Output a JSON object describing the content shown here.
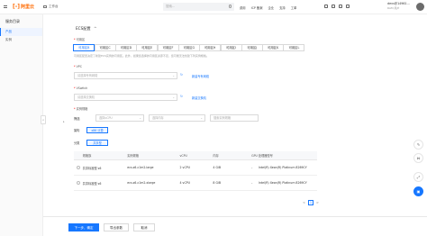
{
  "topbar": {
    "logo_text": "阿里云",
    "workspace": "工作台",
    "search_placeholder": "搜索...",
    "nav": [
      "费用",
      "ICP 备案",
      "企业",
      "支持",
      "工单"
    ],
    "user_name": "devs@14961...",
    "user_sub": "RAM 用户"
  },
  "sidebar": {
    "title": "服务目录",
    "items": [
      {
        "label": "产品",
        "active": true
      },
      {
        "label": "实例",
        "active": false
      }
    ],
    "collapse": "<"
  },
  "section": {
    "title": "ECS配置",
    "toggle": "^"
  },
  "zone": {
    "label": "可用区",
    "options": [
      "可用区B",
      "可用区C",
      "可用区D",
      "可用区E",
      "可用区F",
      "可用区G",
      "可用区H",
      "可用区I",
      "可用区J",
      "可用区K",
      "可用区L"
    ],
    "selected": 0,
    "description": "可用区配置决定了新建ECS实例的可用区。此外，如果您选择的可用区资源不足，您可能无法创建下列实例规格。"
  },
  "vpc": {
    "label": "VPC",
    "placeholder": "请选择专有网络",
    "create_link": "新建专有网络"
  },
  "vswitch": {
    "label": "VSwitch",
    "placeholder": "请选择交换机",
    "create_link": "新建交换机"
  },
  "instance_type": {
    "label": "实例规格",
    "filter_label": "筛选",
    "vcpu_placeholder": "选择vCPU",
    "memory_placeholder": "选择内存",
    "search_placeholder": "搜索实例规格",
    "arch_label": "架构",
    "arch_value": "x86 计算",
    "category_label": "分类",
    "category_value": "共享型"
  },
  "table": {
    "headers": [
      "",
      "规格族",
      "实例规格",
      "vCPU",
      "内存",
      "GPU",
      "处理器型号"
    ],
    "rows": [
      {
        "family": "共享标准型 s6",
        "spec": "ecs.s6-c1m2.large",
        "vcpu": "2 vCPU",
        "memory": "4 GiB",
        "gpu": "-",
        "cpu": "Intel(R) Xeon(R) Platinum 8269CY"
      },
      {
        "family": "共享标准型 s6",
        "spec": "ecs.s6-c1m2.xlarge",
        "vcpu": "4 vCPU",
        "memory": "8 GiB",
        "gpu": "-",
        "cpu": "Intel(R) Xeon(R) Platinum 8269CY"
      }
    ]
  },
  "pagination": {
    "prev": "<",
    "current": "1",
    "next": ">"
  },
  "footer": {
    "next_button": "下一步，确定",
    "export_button": "导出参数",
    "cancel_button": "取消"
  },
  "colors": {
    "accent": "#1677ff",
    "brand": "#ff6a00"
  }
}
